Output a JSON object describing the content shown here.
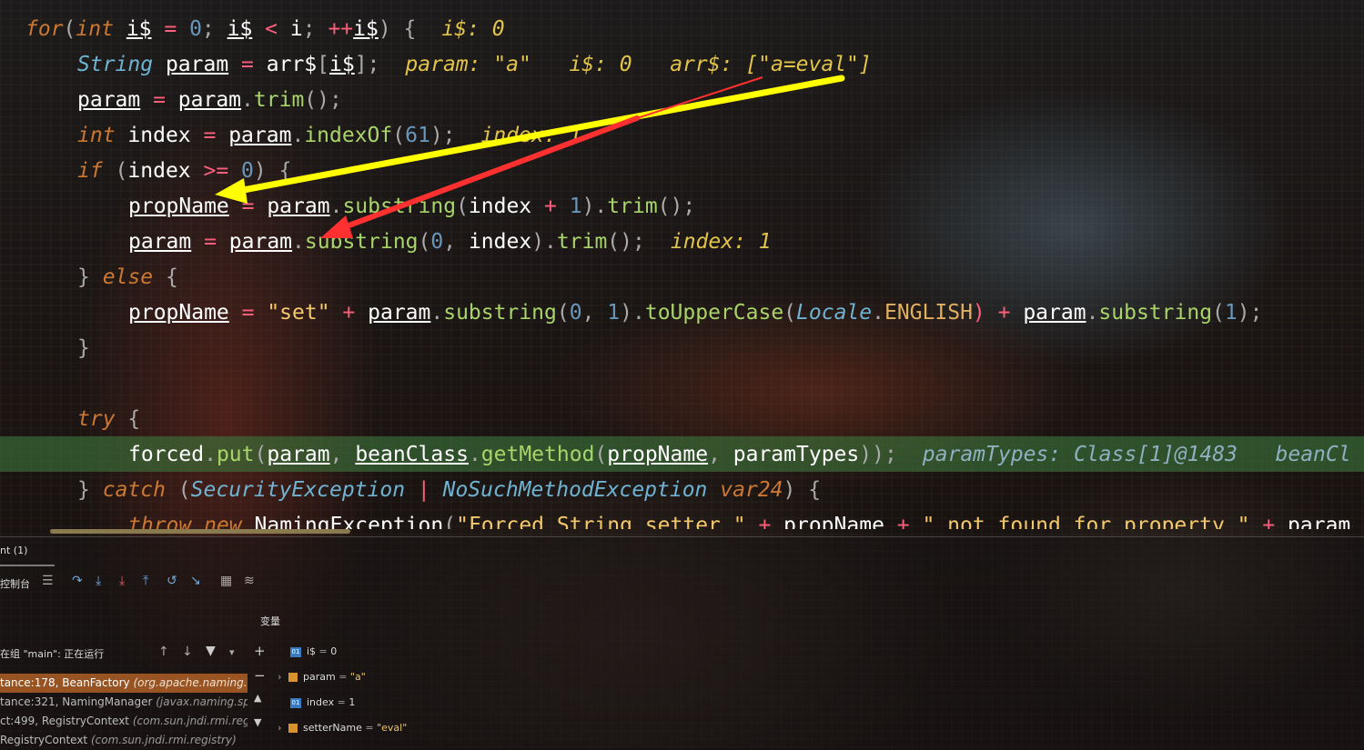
{
  "editor": {
    "lines": [
      {
        "parts": [
          [
            "for",
            "kw"
          ],
          [
            "(",
            "pu"
          ],
          [
            "int",
            "kw"
          ],
          [
            " ",
            "pl"
          ],
          [
            "i$",
            "id"
          ],
          [
            " = ",
            "op"
          ],
          [
            "0",
            "num"
          ],
          [
            "; ",
            "pu"
          ],
          [
            "i$",
            "id"
          ],
          [
            " < ",
            "op"
          ],
          [
            "i",
            "pl"
          ],
          [
            "; ",
            "pu"
          ],
          [
            "++",
            "op"
          ],
          [
            "i$",
            "id"
          ],
          [
            ") {",
            "pu"
          ]
        ],
        "hint": "i$: 0"
      },
      {
        "parts": [
          [
            "String",
            "ty"
          ],
          [
            " ",
            "pl"
          ],
          [
            "param",
            "id"
          ],
          [
            " = ",
            "op"
          ],
          [
            "arr$",
            "pl"
          ],
          [
            "[",
            "pu"
          ],
          [
            "i$",
            "id"
          ],
          [
            "];",
            "pu"
          ]
        ],
        "hint": "param: \"a\"   i$: 0   arr$: [\"a=eval\"]"
      },
      {
        "parts": [
          [
            "param",
            "id"
          ],
          [
            " = ",
            "op"
          ],
          [
            "param",
            "id"
          ],
          [
            ".",
            "pu"
          ],
          [
            "trim",
            "fn"
          ],
          [
            "();",
            "pu"
          ]
        ]
      },
      {
        "parts": [
          [
            "int",
            "kw"
          ],
          [
            " ",
            "pl"
          ],
          [
            "index",
            "pl"
          ],
          [
            " = ",
            "op"
          ],
          [
            "param",
            "id"
          ],
          [
            ".",
            "pu"
          ],
          [
            "indexOf",
            "fn"
          ],
          [
            "(",
            "pu"
          ],
          [
            "61",
            "num"
          ],
          [
            ");",
            "pu"
          ]
        ],
        "hint": "index: 1"
      },
      {
        "parts": [
          [
            "if",
            "kw"
          ],
          [
            " (",
            "pu"
          ],
          [
            "index",
            "pl"
          ],
          [
            " >= ",
            "op"
          ],
          [
            "0",
            "num"
          ],
          [
            ") {",
            "pu"
          ]
        ]
      },
      {
        "parts": [
          [
            "propName",
            "id"
          ],
          [
            " = ",
            "op"
          ],
          [
            "param",
            "id"
          ],
          [
            ".",
            "pu"
          ],
          [
            "substring",
            "fn"
          ],
          [
            "(",
            "pu"
          ],
          [
            "index",
            "pl"
          ],
          [
            " + ",
            "op"
          ],
          [
            "1",
            "num"
          ],
          [
            ").",
            "pu"
          ],
          [
            "trim",
            "fn"
          ],
          [
            "();",
            "pu"
          ]
        ]
      },
      {
        "parts": [
          [
            "param",
            "id"
          ],
          [
            " = ",
            "op"
          ],
          [
            "param",
            "id"
          ],
          [
            ".",
            "pu"
          ],
          [
            "substring",
            "fn"
          ],
          [
            "(",
            "pu"
          ],
          [
            "0",
            "num"
          ],
          [
            ", ",
            "pu"
          ],
          [
            "index",
            "pl"
          ],
          [
            ").",
            "pu"
          ],
          [
            "trim",
            "fn"
          ],
          [
            "();",
            "pu"
          ]
        ],
        "hint": "index: 1"
      },
      {
        "parts": [
          [
            "} ",
            "pu"
          ],
          [
            "else",
            "kw"
          ],
          [
            " {",
            "pu"
          ]
        ]
      },
      {
        "parts": [
          [
            "propName",
            "id"
          ],
          [
            " = ",
            "op"
          ],
          [
            "\"set\"",
            "str"
          ],
          [
            " + ",
            "op"
          ],
          [
            "param",
            "id"
          ],
          [
            ".",
            "pu"
          ],
          [
            "substring",
            "fn"
          ],
          [
            "(",
            "pu"
          ],
          [
            "0",
            "num"
          ],
          [
            ", ",
            "pu"
          ],
          [
            "1",
            "num"
          ],
          [
            ").",
            "pu"
          ],
          [
            "toUpperCase",
            "fn"
          ],
          [
            "(",
            "pu"
          ],
          [
            "Locale",
            "ty"
          ],
          [
            ".",
            "pu"
          ],
          [
            "ENGLISH",
            "cst"
          ],
          [
            ") + ",
            "op"
          ],
          [
            "param",
            "id"
          ],
          [
            ".",
            "pu"
          ],
          [
            "substring",
            "fn"
          ],
          [
            "(",
            "pu"
          ],
          [
            "1",
            "num"
          ],
          [
            ");",
            "pu"
          ]
        ]
      },
      {
        "parts": [
          [
            "}",
            "pu"
          ]
        ]
      },
      {
        "parts": []
      },
      {
        "parts": [
          [
            "try",
            "kw"
          ],
          [
            " {",
            "pu"
          ]
        ]
      },
      {
        "parts": [
          [
            "forced",
            "pl"
          ],
          [
            ".",
            "pu"
          ],
          [
            "put",
            "fn"
          ],
          [
            "(",
            "pu"
          ],
          [
            "param",
            "id"
          ],
          [
            ", ",
            "pu"
          ],
          [
            "beanClass",
            "id"
          ],
          [
            ".",
            "pu"
          ],
          [
            "getMethod",
            "fn"
          ],
          [
            "(",
            "pu"
          ],
          [
            "propName",
            "id"
          ],
          [
            ", ",
            "pu"
          ],
          [
            "paramTypes",
            "pl"
          ],
          [
            "));",
            "pu"
          ]
        ],
        "hint": "paramTypes: Class[1]@1483   beanCl",
        "hintStyle": "hint2"
      },
      {
        "parts": [
          [
            "} ",
            "pu"
          ],
          [
            "catch",
            "kw"
          ],
          [
            " (",
            "pu"
          ],
          [
            "SecurityException",
            "ty"
          ],
          [
            " | ",
            "op"
          ],
          [
            "NoSuchMethodException",
            "ty"
          ],
          [
            " ",
            "pl"
          ],
          [
            "var24",
            "kw"
          ],
          [
            ") {",
            "pu"
          ]
        ]
      },
      {
        "parts": [
          [
            "throw",
            "kw"
          ],
          [
            " ",
            "pl"
          ],
          [
            "new",
            "kw"
          ],
          [
            " ",
            "pl"
          ],
          [
            "NamingException",
            "pl"
          ],
          [
            "(",
            "pu"
          ],
          [
            "\"Forced String setter \"",
            "str"
          ],
          [
            " + ",
            "op"
          ],
          [
            "propName",
            "pl"
          ],
          [
            " + ",
            "op"
          ],
          [
            "\" not found for property \"",
            "str"
          ],
          [
            " + ",
            "op"
          ],
          [
            "param",
            "pl"
          ]
        ]
      }
    ]
  },
  "debug": {
    "tab_label": "nt (1)",
    "console_label": "控制台",
    "variables_label": "变量",
    "thread_label": "在组 \"main\": 正在运行",
    "frames": [
      {
        "name": "tance:178, BeanFactory ",
        "pkg": "(org.apache.naming.fac",
        "selected": true
      },
      {
        "name": "tance:321, NamingManager ",
        "pkg": "(javax.naming.spi)",
        "selected": false
      },
      {
        "name": "ct:499, RegistryContext ",
        "pkg": "(com.sun.jndi.rmi.regist",
        "selected": false
      },
      {
        "name": "RegistryContext ",
        "pkg": "(com.sun.jndi.rmi.registry)",
        "selected": false
      }
    ],
    "variables": [
      {
        "name": "i$",
        "value": "0",
        "type": "int",
        "expandable": false
      },
      {
        "name": "param",
        "value": "\"a\"",
        "type": "obj",
        "expandable": true
      },
      {
        "name": "index",
        "value": "1",
        "type": "int",
        "expandable": false
      },
      {
        "name": "setterName",
        "value": "\"eval\"",
        "type": "obj",
        "expandable": true
      }
    ],
    "icons": [
      "console-list-icon",
      "step-over-icon",
      "step-into-icon",
      "force-step-into-icon",
      "step-out-icon",
      "drop-frame-icon",
      "run-to-cursor-icon",
      "evaluate-icon",
      "trace-icon"
    ]
  },
  "colors": {
    "highlight_line": "#3c783c",
    "arrow_yellow": "#ffff00",
    "arrow_red": "#ff3030",
    "selected_frame": "#c46a28"
  }
}
